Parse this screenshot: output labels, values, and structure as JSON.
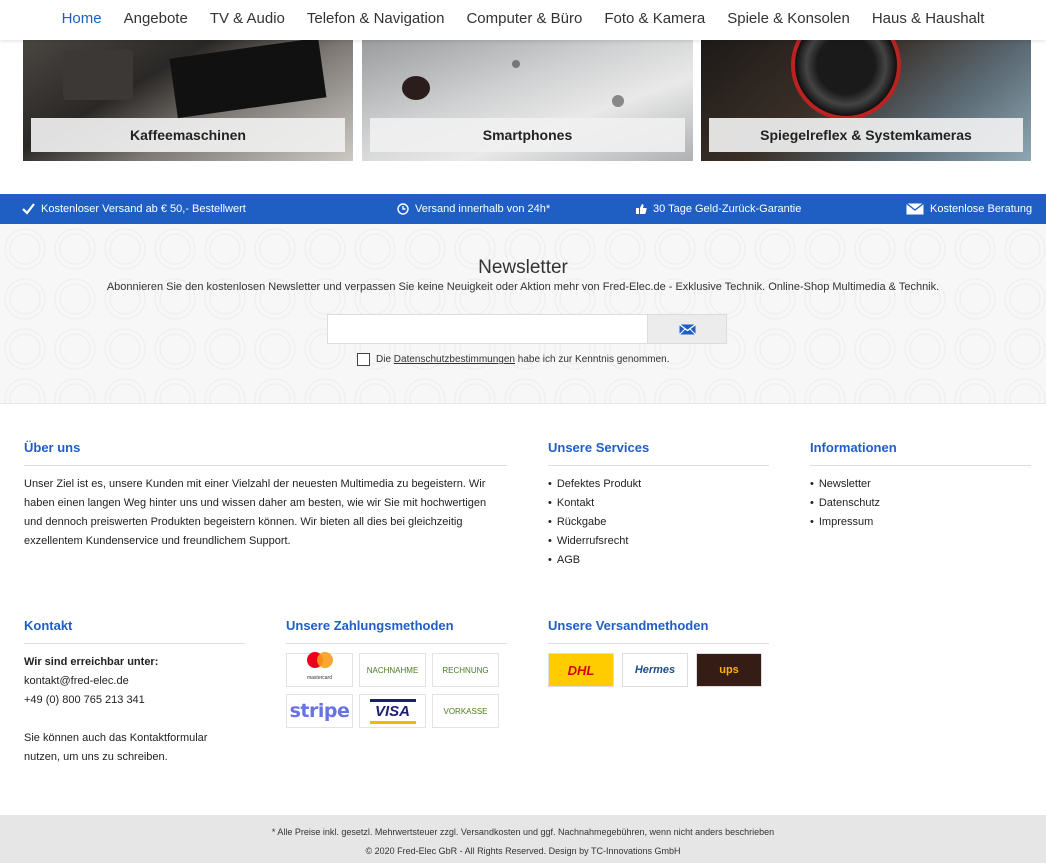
{
  "nav": {
    "items": [
      "Home",
      "Angebote",
      "TV & Audio",
      "Telefon & Navigation",
      "Computer & Büro",
      "Foto & Kamera",
      "Spiele & Konsolen",
      "Haus & Haushalt"
    ]
  },
  "tiles": [
    "Kaffeemaschinen",
    "Smartphones",
    "Spiegelreflex & Systemkameras"
  ],
  "usp": {
    "shipping": "Kostenloser Versand ab € 50,- Bestellwert",
    "delivery": "Versand innerhalb von 24h*",
    "guarantee": "30 Tage Geld-Zurück-Garantie",
    "advice": "Kostenlose Beratung"
  },
  "newsletter": {
    "title": "Newsletter",
    "subtitle": "Abonnieren Sie den kostenlosen Newsletter und verpassen Sie keine Neuigkeit oder Aktion mehr von Fred-Elec.de - Exklusive Technik. Online-Shop Multimedia & Technik.",
    "email_value": "",
    "consent_pre": "Die",
    "consent_link": "Datenschutzbestimmungen",
    "consent_post": "habe ich zur Kenntnis genommen."
  },
  "about": {
    "title": "Über uns",
    "text": "Unser Ziel ist es, unsere Kunden mit einer Vielzahl der neuesten Multimedia zu begeistern. Wir haben einen langen Weg hinter uns und wissen daher am besten, wie wir Sie mit hochwertigen und dennoch preiswerten Produkten begeistern können. Wir bieten all dies bei gleichzeitig exzellentem Kundenservice und freundlichem Support."
  },
  "services": {
    "title": "Unsere Services",
    "items": [
      "Defektes Produkt",
      "Kontakt",
      "Rückgabe",
      "Widerrufsrecht",
      "AGB"
    ]
  },
  "info": {
    "title": "Informationen",
    "items": [
      "Newsletter",
      "Datenschutz",
      "Impressum"
    ]
  },
  "contact": {
    "title": "Kontakt",
    "reachable": "Wir sind erreichbar unter:",
    "email": "kontakt@fred-elec.de",
    "phone": "+49 (0) 800 765 213 341",
    "note": "Sie können auch das Kontaktformular nutzen, um uns zu schreiben."
  },
  "payment": {
    "title": "Unsere Zahlungsmethoden",
    "mastercard": "mastercard",
    "cod": "NACHNAHME",
    "invoice": "RECHNUNG",
    "stripe": "stripe",
    "visa": "VISA",
    "prepay": "VORKASSE"
  },
  "shipping": {
    "title": "Unsere Versandmethoden",
    "dhl": "DHL",
    "hermes": "Hermes",
    "ups": "ups"
  },
  "bottom": {
    "disclaimer": "* Alle Preise inkl. gesetzl. Mehrwertsteuer zzgl. Versandkosten und ggf. Nachnahmegebühren, wenn nicht anders beschrieben",
    "copyright": "© 2020 Fred-Elec GbR - All Rights Reserved. Design by TC-Innovations GmbH"
  },
  "colors": {
    "accent": "#1f5fc4",
    "footer_bg": "#e6e6e6"
  }
}
